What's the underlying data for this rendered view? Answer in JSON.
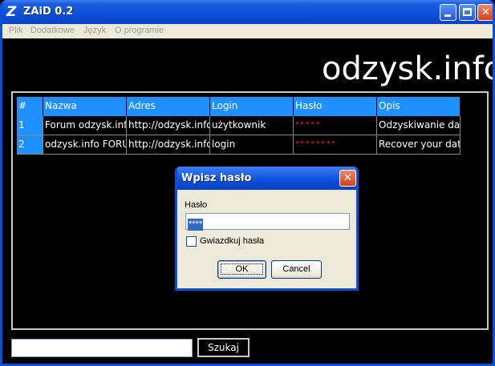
{
  "window": {
    "title": "ZAiD 0.2",
    "app_icon": "Z"
  },
  "titlebar_buttons": {
    "minimize": "minimize-icon",
    "maximize": "maximize-icon",
    "close": "✕"
  },
  "menu": [
    {
      "label": "Plik"
    },
    {
      "label": "Dodatkowe"
    },
    {
      "label": "Język"
    },
    {
      "label": "O programie"
    }
  ],
  "banner": {
    "text": "odzysk.info"
  },
  "table": {
    "columns": [
      "#",
      "Nazwa",
      "Adres",
      "Login",
      "Hasło",
      "Opis"
    ],
    "rows": [
      [
        "1",
        "Forum odzysk.info",
        "http://odzysk.info",
        "użytkownik",
        "*****",
        "Odzyskiwanie danych"
      ],
      [
        "2",
        "odzysk.info FORUM",
        "http://odzysk.info",
        "login",
        "********",
        "Recover your data"
      ]
    ]
  },
  "dialog": {
    "title": "Wpisz hasło",
    "close": "✕",
    "label": "Hasło",
    "password_value": "****",
    "checkbox_label": "Gwiazdkuj hasła",
    "checkbox_checked": false,
    "ok": "OK",
    "cancel": "Cancel"
  },
  "search": {
    "value": "",
    "button": "Szukaj"
  },
  "colors": {
    "accent": "#1e90ff",
    "titlebar": "#0a4fd8",
    "password": "#ff2020"
  }
}
